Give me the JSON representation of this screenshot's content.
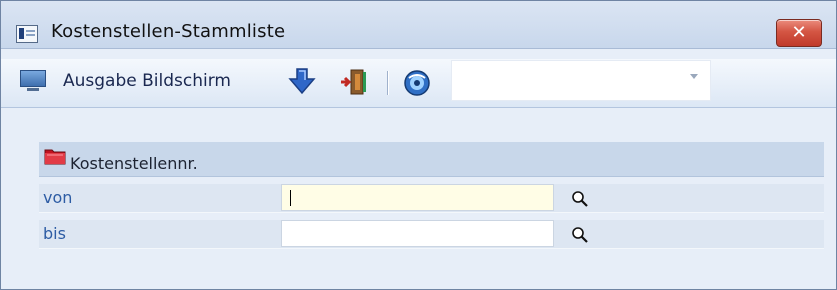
{
  "window": {
    "title": "Kostenstellen-Stammliste",
    "close_label": "✕"
  },
  "toolbar": {
    "output_label": "Ausgabe Bildschirm",
    "combo": {
      "value": ""
    }
  },
  "section": {
    "title": "Kostenstellennr.",
    "rows": [
      {
        "label": "von",
        "value": ""
      },
      {
        "label": "bis",
        "value": ""
      }
    ]
  }
}
